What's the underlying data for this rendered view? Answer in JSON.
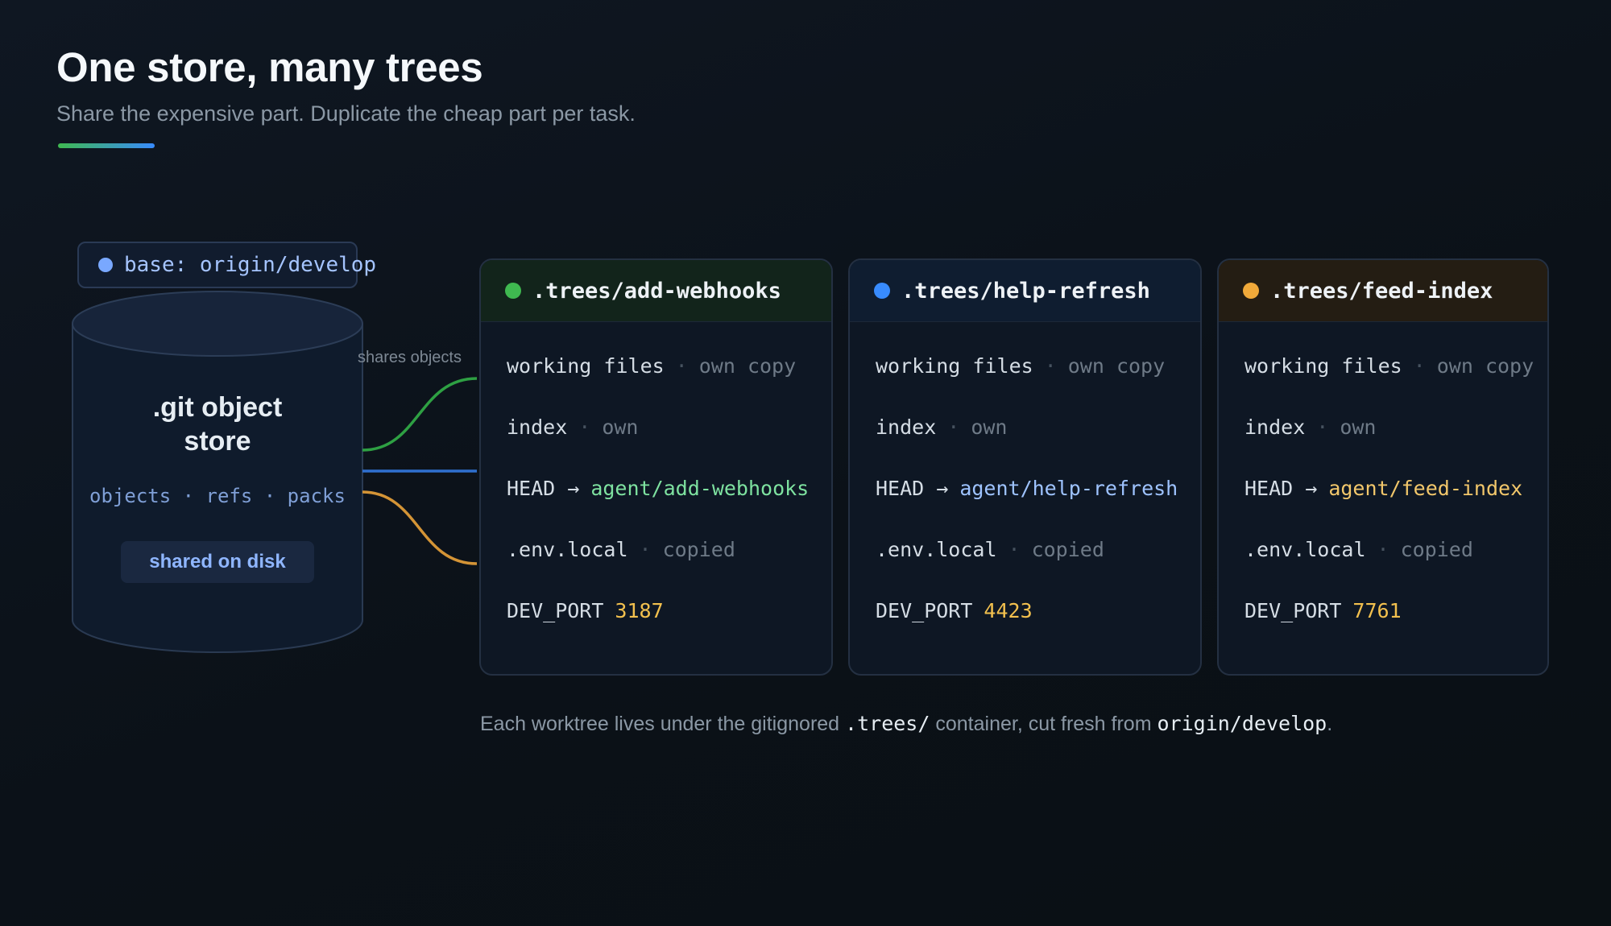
{
  "header": {
    "title": "One store, many trees",
    "subtitle": "Share the expensive part. Duplicate the cheap part per task."
  },
  "base_badge": {
    "label": "base: origin/develop",
    "color": "#79a8ff"
  },
  "store": {
    "title_line1": ".git object",
    "title_line2": "store",
    "subtitle": "objects · refs · packs",
    "pill": "shared on disk"
  },
  "link_label": "shares objects",
  "row_labels": {
    "working_files": "working files",
    "own_copy": "own copy",
    "index": "index",
    "own": "own",
    "head": "HEAD →",
    "env": ".env.local",
    "copied": "copied",
    "dev_port": "DEV_PORT",
    "separator": "·"
  },
  "trees": [
    {
      "name": ".trees/add-webhooks",
      "branch": "agent/add-webhooks",
      "port": "3187",
      "color": "#3fb950",
      "branch_color": "#7ee2a0",
      "header_bg": "#12241b",
      "link_color": "#2ea043"
    },
    {
      "name": ".trees/help-refresh",
      "branch": "agent/help-refresh",
      "port": "4423",
      "color": "#388bfd",
      "branch_color": "#9ec3ff",
      "header_bg": "#0f1d30",
      "link_color": "#2f6fcf"
    },
    {
      "name": ".trees/feed-index",
      "branch": "agent/feed-index",
      "port": "7761",
      "color": "#f0a93a",
      "branch_color": "#f2c76b",
      "header_bg": "#241d13",
      "link_color": "#d49436"
    }
  ],
  "port_color": "#f2c04e",
  "footer": {
    "text1": "Each worktree lives under the gitignored",
    "code1": ".trees/",
    "text2": "container, cut fresh from",
    "code2": "origin/develop",
    "text3": "."
  }
}
